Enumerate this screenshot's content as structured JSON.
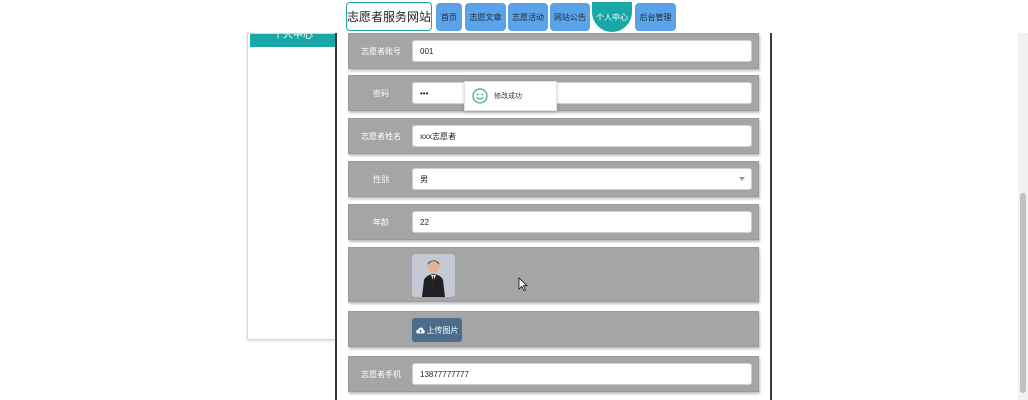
{
  "brand": "志愿者服务网站",
  "nav": [
    {
      "label": "首页"
    },
    {
      "label": "志愿文章"
    },
    {
      "label": "志愿活动"
    },
    {
      "label": "网站公告"
    },
    {
      "label": "个人中心"
    },
    {
      "label": "后台管理"
    }
  ],
  "side_panel": {
    "title": "个人中心"
  },
  "form": {
    "account": {
      "label": "志愿者账号",
      "value": "001"
    },
    "password": {
      "label": "密码",
      "value": "•••"
    },
    "name": {
      "label": "志愿者姓名",
      "value": "xxx志愿者"
    },
    "gender": {
      "label": "性别",
      "value": "男"
    },
    "age": {
      "label": "年龄",
      "value": "22"
    },
    "upload_label": "上传图片",
    "phone": {
      "label": "志愿者手机",
      "value": "13877777777"
    }
  },
  "toast": {
    "message": "修改成功",
    "icon": "smile-icon"
  },
  "colors": {
    "accent": "#1aa7a8",
    "nav_button": "#5aa3e8",
    "row_bg": "#a5a5a5",
    "upload_button": "#4b6c8b"
  }
}
